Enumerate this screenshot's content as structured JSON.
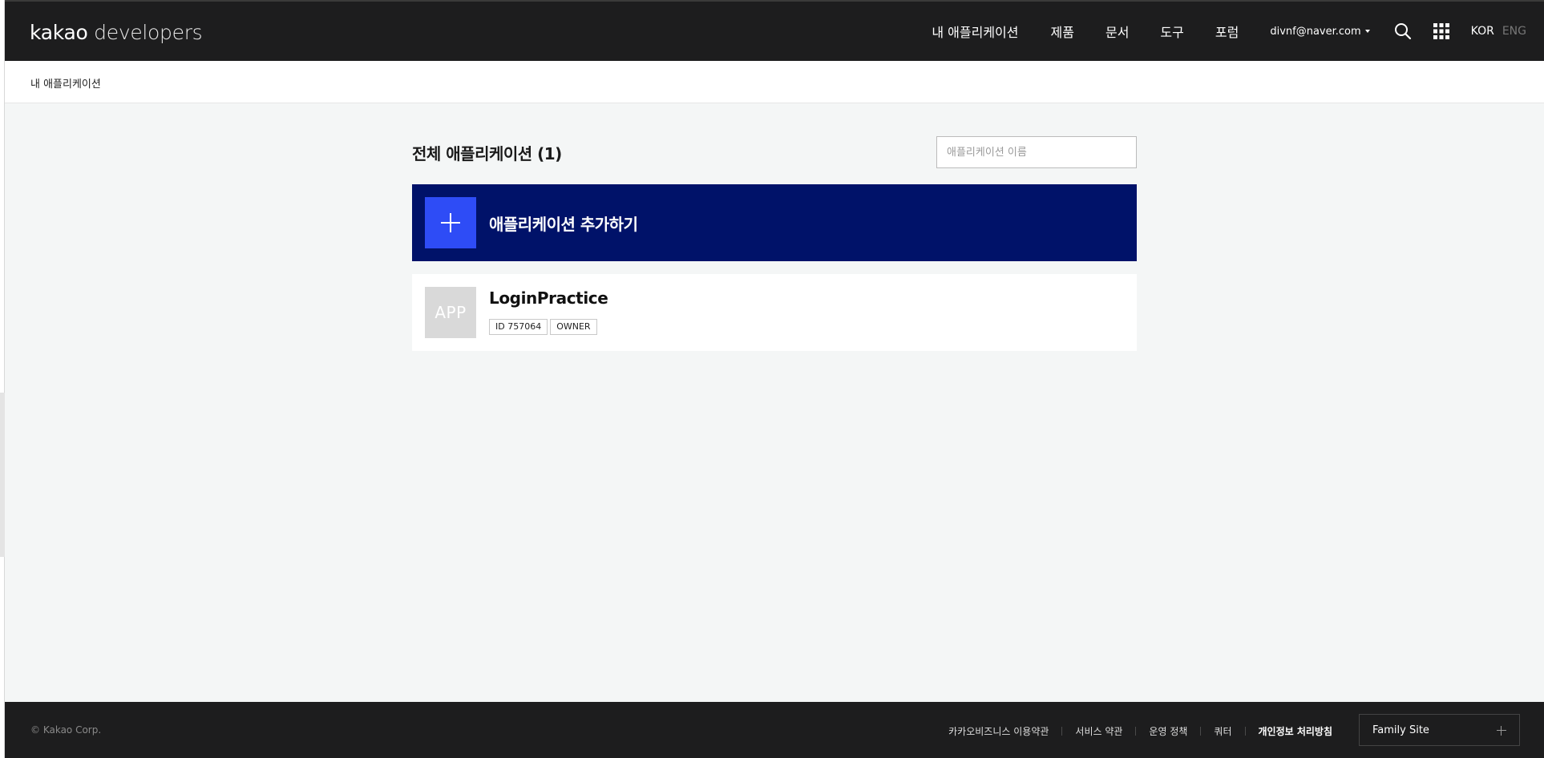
{
  "header": {
    "logo_primary": "kakao",
    "logo_secondary": "developers",
    "nav": [
      "내 애플리케이션",
      "제품",
      "문서",
      "도구",
      "포럼"
    ],
    "account": "divnf@naver.com",
    "search_icon": "search-icon",
    "apps_icon": "grid-icon",
    "languages": {
      "active": "KOR",
      "inactive": "ENG"
    }
  },
  "breadcrumb": {
    "current": "내 애플리케이션"
  },
  "main": {
    "title": "전체 애플리케이션 (1)",
    "search_placeholder": "애플리케이션 이름",
    "add_label": "애플리케이션 추가하기",
    "apps": [
      {
        "thumb": "APP",
        "name": "LoginPractice",
        "id_tag": "ID 757064",
        "role_tag": "OWNER"
      }
    ]
  },
  "footer": {
    "copyright": "© Kakao Corp.",
    "links": [
      "카카오비즈니스 이용약관",
      "서비스 약관",
      "운영 정책",
      "쿼터",
      "개인정보 처리방침"
    ],
    "family_site": "Family Site"
  },
  "colors": {
    "header_bg": "#1d1d1e",
    "add_card_bg": "#001269",
    "add_icon_bg": "#2e4cf6",
    "page_bg": "#f4f6f6"
  }
}
